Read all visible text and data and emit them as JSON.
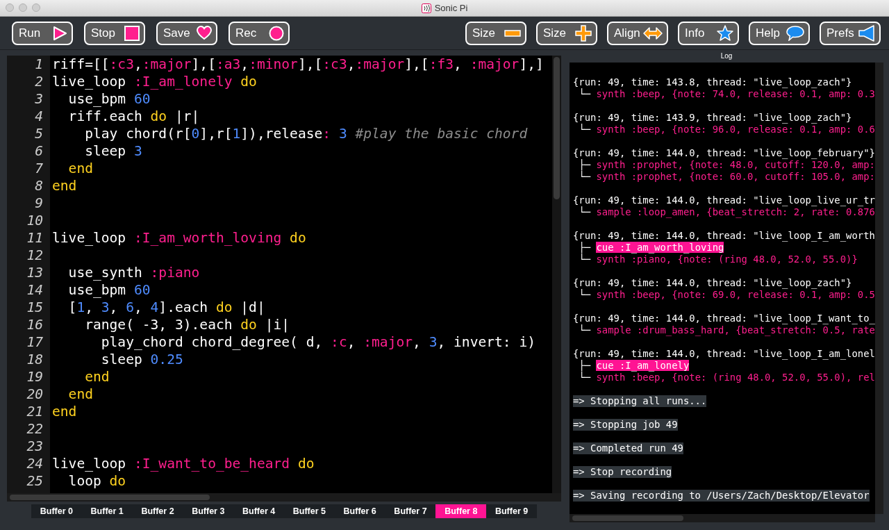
{
  "window": {
    "title": "Sonic Pi"
  },
  "toolbar": {
    "left": [
      "Run",
      "Stop",
      "Save",
      "Rec"
    ],
    "right": [
      "Size",
      "Size",
      "Align",
      "Info",
      "Help",
      "Prefs"
    ]
  },
  "editor": {
    "lines": [
      {
        "number": "1",
        "tokens": [
          {
            "kind": "plain",
            "text": "riff=[["
          },
          {
            "kind": "symbol",
            "text": ":c3"
          },
          {
            "kind": "plain",
            "text": ","
          },
          {
            "kind": "symbol",
            "text": ":major"
          },
          {
            "kind": "plain",
            "text": "],["
          },
          {
            "kind": "symbol",
            "text": ":a3"
          },
          {
            "kind": "plain",
            "text": ","
          },
          {
            "kind": "symbol",
            "text": ":minor"
          },
          {
            "kind": "plain",
            "text": "],["
          },
          {
            "kind": "symbol",
            "text": ":c3"
          },
          {
            "kind": "plain",
            "text": ","
          },
          {
            "kind": "symbol",
            "text": ":major"
          },
          {
            "kind": "plain",
            "text": "],["
          },
          {
            "kind": "symbol",
            "text": ":f3"
          },
          {
            "kind": "plain",
            "text": ", "
          },
          {
            "kind": "symbol",
            "text": ":major"
          },
          {
            "kind": "plain",
            "text": "],]"
          }
        ]
      },
      {
        "number": "2",
        "tokens": [
          {
            "kind": "plain",
            "text": "live_loop "
          },
          {
            "kind": "symbol",
            "text": ":I_am_lonely"
          },
          {
            "kind": "keyword",
            "text": " do"
          }
        ]
      },
      {
        "number": "3",
        "tokens": [
          {
            "kind": "plain",
            "text": "  use_bpm "
          },
          {
            "kind": "number",
            "text": "60"
          }
        ]
      },
      {
        "number": "4",
        "tokens": [
          {
            "kind": "plain",
            "text": "  riff.each "
          },
          {
            "kind": "keyword",
            "text": "do"
          },
          {
            "kind": "plain",
            "text": " |r|"
          }
        ]
      },
      {
        "number": "5",
        "tokens": [
          {
            "kind": "plain",
            "text": "    play chord(r["
          },
          {
            "kind": "number",
            "text": "0"
          },
          {
            "kind": "plain",
            "text": "],r["
          },
          {
            "kind": "number",
            "text": "1"
          },
          {
            "kind": "plain",
            "text": "]),release"
          },
          {
            "kind": "symbol",
            "text": ":"
          },
          {
            "kind": "number",
            "text": " 3"
          },
          {
            "kind": "comment",
            "text": " #play the basic chord"
          }
        ]
      },
      {
        "number": "6",
        "tokens": [
          {
            "kind": "plain",
            "text": "    sleep "
          },
          {
            "kind": "number",
            "text": "3"
          }
        ]
      },
      {
        "number": "7",
        "tokens": [
          {
            "kind": "keyword",
            "text": "  end"
          }
        ]
      },
      {
        "number": "8",
        "tokens": [
          {
            "kind": "keyword",
            "text": "end"
          }
        ]
      },
      {
        "number": "9"
      },
      {
        "number": "10"
      },
      {
        "number": "11",
        "tokens": [
          {
            "kind": "plain",
            "text": "live_loop "
          },
          {
            "kind": "symbol",
            "text": ":I_am_worth_loving"
          },
          {
            "kind": "keyword",
            "text": " do"
          }
        ]
      },
      {
        "number": "12"
      },
      {
        "number": "13",
        "tokens": [
          {
            "kind": "plain",
            "text": "  use_synth "
          },
          {
            "kind": "symbol",
            "text": ":piano"
          }
        ]
      },
      {
        "number": "14",
        "tokens": [
          {
            "kind": "plain",
            "text": "  use_bpm "
          },
          {
            "kind": "number",
            "text": "60"
          }
        ]
      },
      {
        "number": "15",
        "tokens": [
          {
            "kind": "plain",
            "text": "  ["
          },
          {
            "kind": "number",
            "text": "1"
          },
          {
            "kind": "plain",
            "text": ", "
          },
          {
            "kind": "number",
            "text": "3"
          },
          {
            "kind": "plain",
            "text": ", "
          },
          {
            "kind": "number",
            "text": "6"
          },
          {
            "kind": "plain",
            "text": ", "
          },
          {
            "kind": "number",
            "text": "4"
          },
          {
            "kind": "plain",
            "text": "].each "
          },
          {
            "kind": "keyword",
            "text": "do"
          },
          {
            "kind": "plain",
            "text": " |d|"
          }
        ]
      },
      {
        "number": "16",
        "tokens": [
          {
            "kind": "plain",
            "text": "    range( -3, 3).each "
          },
          {
            "kind": "keyword",
            "text": "do"
          },
          {
            "kind": "plain",
            "text": " |i|"
          }
        ]
      },
      {
        "number": "17",
        "tokens": [
          {
            "kind": "plain",
            "text": "      play_chord chord_degree( d, "
          },
          {
            "kind": "symbol",
            "text": ":c"
          },
          {
            "kind": "plain",
            "text": ", "
          },
          {
            "kind": "symbol",
            "text": ":major"
          },
          {
            "kind": "plain",
            "text": ", "
          },
          {
            "kind": "number",
            "text": "3"
          },
          {
            "kind": "plain",
            "text": ", invert: i)"
          }
        ]
      },
      {
        "number": "18",
        "tokens": [
          {
            "kind": "plain",
            "text": "      sleep "
          },
          {
            "kind": "number",
            "text": "0.25"
          }
        ]
      },
      {
        "number": "19",
        "tokens": [
          {
            "kind": "keyword",
            "text": "    end"
          }
        ]
      },
      {
        "number": "20",
        "tokens": [
          {
            "kind": "keyword",
            "text": "  end"
          }
        ]
      },
      {
        "number": "21",
        "tokens": [
          {
            "kind": "keyword",
            "text": "end"
          }
        ]
      },
      {
        "number": "22"
      },
      {
        "number": "23"
      },
      {
        "number": "24",
        "tokens": [
          {
            "kind": "plain",
            "text": "live_loop "
          },
          {
            "kind": "symbol",
            "text": ":I_want_to_be_heard"
          },
          {
            "kind": "keyword",
            "text": " do"
          }
        ]
      },
      {
        "number": "25",
        "tokens": [
          {
            "kind": "plain",
            "text": "  loop "
          },
          {
            "kind": "keyword",
            "text": "do"
          }
        ]
      }
    ]
  },
  "buffers": [
    {
      "label": "Buffer 0",
      "selected": false
    },
    {
      "label": "Buffer 1",
      "selected": false
    },
    {
      "label": "Buffer 2",
      "selected": false
    },
    {
      "label": "Buffer 3",
      "selected": false
    },
    {
      "label": "Buffer 4",
      "selected": false
    },
    {
      "label": "Buffer 5",
      "selected": false
    },
    {
      "label": "Buffer 6",
      "selected": false
    },
    {
      "label": "Buffer 7",
      "selected": false
    },
    {
      "label": "Buffer 8",
      "selected": true
    },
    {
      "label": "Buffer 9",
      "selected": false
    }
  ],
  "log": {
    "title": "Log",
    "entries": [
      {
        "header": "{run: 49, time: 143.8, thread: \"live_loop_zach\"}",
        "items": [
          {
            "branch": "└─",
            "text": "synth :beep, {note: 74.0, release: 0.1, amp: 0.3",
            "highlighted": false
          }
        ]
      },
      {
        "header": "{run: 49, time: 143.9, thread: \"live_loop_zach\"}",
        "items": [
          {
            "branch": "└─",
            "text": "synth :beep, {note: 96.0, release: 0.1, amp: 0.6",
            "highlighted": false
          }
        ]
      },
      {
        "header": "{run: 49, time: 144.0, thread: \"live_loop_february\"}",
        "items": [
          {
            "branch": "├─",
            "text": "synth :prophet, {note: 48.0, cutoff: 120.0, amp:",
            "highlighted": false
          },
          {
            "branch": "└─",
            "text": "synth :prophet, {note: 60.0, cutoff: 105.0, amp:",
            "highlighted": false
          }
        ]
      },
      {
        "header": "{run: 49, time: 144.0, thread: \"live_loop_live_ur_tr",
        "items": [
          {
            "branch": "└─",
            "text": "sample :loop_amen, {beat_stretch: 2, rate: 0.876",
            "highlighted": false
          }
        ]
      },
      {
        "header": "{run: 49, time: 144.0, thread: \"live_loop_I_am_worth",
        "items": [
          {
            "branch": "├─",
            "text": "cue :I_am_worth_loving",
            "highlighted": true
          },
          {
            "branch": "└─",
            "text": "synth :piano, {note: (ring 48.0, 52.0, 55.0)}",
            "highlighted": false
          }
        ]
      },
      {
        "header": "{run: 49, time: 144.0, thread: \"live_loop_zach\"}",
        "items": [
          {
            "branch": "└─",
            "text": "synth :beep, {note: 69.0, release: 0.1, amp: 0.5",
            "highlighted": false
          }
        ]
      },
      {
        "header": "{run: 49, time: 144.0, thread: \"live_loop_I_want_to_",
        "items": [
          {
            "branch": "└─",
            "text": "sample :drum_bass_hard, {beat_stretch: 0.5, rate",
            "highlighted": false
          }
        ]
      },
      {
        "header": "{run: 49, time: 144.0, thread: \"live_loop_I_am_lonel",
        "items": [
          {
            "branch": "├─",
            "text": "cue :I_am_lonely",
            "highlighted": true
          },
          {
            "branch": "└─",
            "text": "synth :beep, {note: (ring 48.0, 52.0, 55.0), rel",
            "highlighted": false
          }
        ]
      }
    ],
    "messages": [
      "=> Stopping all runs...",
      "=> Stopping job 49",
      "=> Completed run 49",
      "=> Stop recording",
      "=> Saving recording to /Users/Zach/Desktop/Elevator"
    ]
  }
}
